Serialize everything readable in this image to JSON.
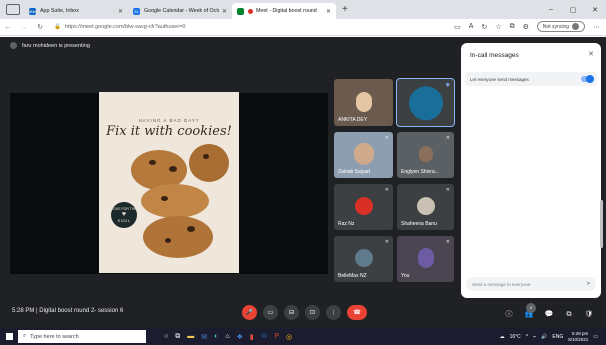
{
  "browser": {
    "tabs": [
      {
        "title": "App Suite, Inbox",
        "favicon_text": "IBM",
        "color": "#0a66c2",
        "active": false
      },
      {
        "title": "Google Calendar - Week of Octo",
        "favicon_text": "31",
        "color": "#1a73e8",
        "active": false
      },
      {
        "title": "Meet - Digital boost round",
        "favicon_text": "",
        "color": "#00832d",
        "active": true
      }
    ],
    "new_tab": "+",
    "url": "https://meet.google.com/blw-savg-cfr?authuser=0",
    "sync_label": "Not syncing",
    "window_controls": {
      "minimize": "–",
      "maximize": "▢",
      "close": "✕"
    }
  },
  "meet": {
    "presenting_text": "faru mohideen is presenting",
    "slide": {
      "kicker": "HAVING A BAD DAY?",
      "headline": "Fix it with cookies!",
      "logo_top": "LOVE FOR THE",
      "logo_bottom": "SOUL"
    },
    "participants": [
      {
        "name": "ANKITA DEY",
        "color": "#6b5a4e",
        "muted": false
      },
      {
        "name": "",
        "color": "#1a6e9a",
        "muted": false
      },
      {
        "name": "Zainab Saiyad",
        "color": "#7a8a9b",
        "muted": true
      },
      {
        "name": "Englyen Shivra...",
        "color": "#5b6064",
        "muted": true
      },
      {
        "name": "Raz Nz",
        "color": "#d93025",
        "muted": true
      },
      {
        "name": "Shaheena Banu",
        "color": "#c9c2b4",
        "muted": true
      },
      {
        "name": "BelleMax NZ",
        "color": "#5f7a8c",
        "muted": true
      },
      {
        "name": "You",
        "color": "#6d5ca3",
        "muted": false
      }
    ],
    "clock_text": "5:28 PM",
    "meeting_title": "Digital boost round 2- session 6",
    "controls": {
      "mic": "🎤",
      "camera": "▭",
      "captions": "⊟",
      "present": "⊡",
      "more": "⋮",
      "end": "☎"
    },
    "right_controls": {
      "info": "ⓘ",
      "people": "👥",
      "chat": "💬",
      "activities": "⧉",
      "safety": "🛡"
    },
    "people_count": "8"
  },
  "chat_panel": {
    "title": "In-call messages",
    "close": "✕",
    "setting_label": "Let everyone send messages",
    "setting_on": true,
    "input_placeholder": "Send a message to everyone",
    "send_icon": "➤"
  },
  "taskbar": {
    "search_placeholder": "Type here to search",
    "weather": "16°C",
    "lang": "ENG",
    "time": "5:28 pm",
    "date": "8/10/2021"
  }
}
